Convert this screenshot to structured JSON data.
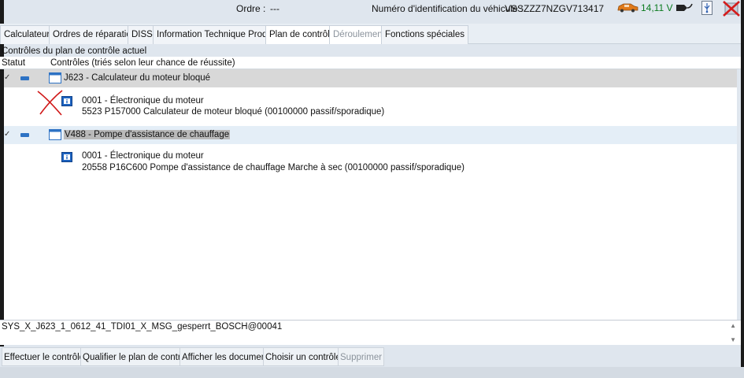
{
  "header": {
    "order_label": "Ordre :",
    "order_value": "---",
    "vin_label": "Numéro d'identification du véhicule :",
    "vin_value": "VSSZZZ7NZGV713417",
    "voltage": "14,11 V",
    "icons": [
      "car-icon",
      "obd-connector-icon",
      "usb-icon",
      "close-icon"
    ]
  },
  "tabs": [
    {
      "label": "Calculateurs",
      "state": "normal"
    },
    {
      "label": "Ordres de réparation",
      "state": "normal"
    },
    {
      "label": "DISS",
      "state": "normal"
    },
    {
      "label": "Information Technique Produit",
      "state": "normal"
    },
    {
      "label": "Plan de contrôle",
      "state": "active"
    },
    {
      "label": "Déroulement",
      "state": "disabled"
    },
    {
      "label": "Fonctions spéciales",
      "state": "normal"
    }
  ],
  "section_title": "Contrôles du plan de contrôle actuel",
  "columns": {
    "statut": "Statut",
    "controles": "Contrôles (triés selon leur chance de réussite)"
  },
  "groups": [
    {
      "label": "J623 - Calculateur du moteur bloqué",
      "status": "✓",
      "detail_title": "0001 - Électronique du moteur",
      "detail_line": "5523   P157000   Calculateur de moteur bloqué  (00100000   passif/sporadique)"
    },
    {
      "label": "V488 - Pompe d'assistance de chauffage",
      "status": "✓",
      "detail_title": "0001 - Électronique du moteur",
      "detail_line": "20558   P16C600   Pompe d'assistance de chauffage Marche à sec  (00100000   passif/sporadique)"
    }
  ],
  "info_text": "SYS_X_J623_1_0612_41_TDI01_X_MSG_gesperrt_BOSCH@00041",
  "buttons": [
    {
      "label": "Effectuer le contrôle...",
      "state": "normal"
    },
    {
      "label": "Qualifier le plan de contrôle",
      "state": "normal"
    },
    {
      "label": "Afficher les documents",
      "state": "normal"
    },
    {
      "label": "Choisir un contrôle...",
      "state": "normal"
    },
    {
      "label": "Supprimer",
      "state": "disabled"
    }
  ],
  "colors": {
    "voltage": "#0a7a1e",
    "status_bar": "#2d72c4",
    "info_icon": "#1d63c0",
    "annotation": "#d01818"
  }
}
